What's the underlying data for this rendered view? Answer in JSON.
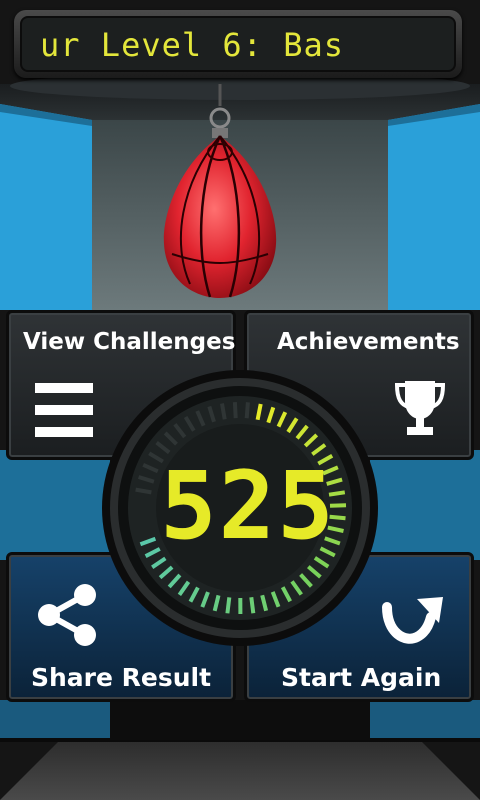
{
  "ticker": {
    "text": "ur          Level 6: Bas"
  },
  "buttons": {
    "view_challenges": "View Challenges",
    "achievements": "Achievements",
    "share_result": "Share Result",
    "start_again": "Start Again"
  },
  "score": {
    "value": "525",
    "dial_fill_fraction": 0.72
  },
  "colors": {
    "accent_blue": "#2ea3dd",
    "score_yellow": "#e6ea28",
    "bag_red": "#d8202a"
  },
  "icons": {
    "menu": "hamburger-menu-icon",
    "trophy": "trophy-icon",
    "share": "share-icon",
    "restart": "restart-arrow-icon"
  }
}
